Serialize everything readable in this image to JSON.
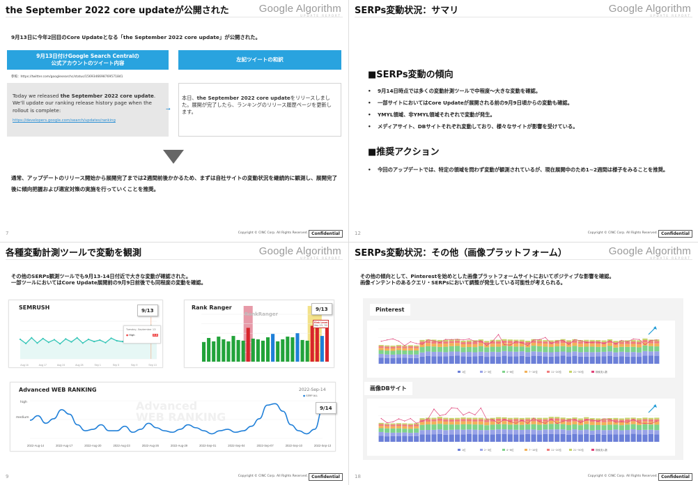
{
  "brand": "Google Algorithm",
  "brand_sub": "UPDATE REPORT",
  "copyright": "Copyright © CINC Corp. All Rights Reserved.",
  "confidential": "Confidential",
  "slide_tl": {
    "title": "the September 2022 core updateが公開された",
    "page": "7",
    "intro": "9月13日に今年2回目のCore Updateとなる「the September 2022 core update」が公開された。",
    "left_header_line1": "9月13日付けGoogle Search Centralの",
    "left_header_line2": "公式アカウントのツイート内容",
    "right_header": "左記ツイートの和訳",
    "reference": "参照：https://twitter.com/googlesearchc/status/1569346698769571841",
    "tweet_en_pre": "Today we released ",
    "tweet_en_bold": "the September 2022 core update",
    "tweet_en_post": ". We'll update our ranking release history page when the rollout is complete:",
    "tweet_en_link": "https://developers.google.com/search/updates/ranking",
    "tweet_ja_pre": "本日、",
    "tweet_ja_bold": "the September 2022 core update",
    "tweet_ja_post": "をリリースしました。展開が完了したら、ランキングのリリース履歴ページを更新します。",
    "conclusion": "通常、アップデートのリリース開始から展開完了までは2週間前後かかるため、まずは自社サイトの変動状況を継続的に観測し、展開完了後に傾向把握および適宜対策の実施を行っていくことを推奨。"
  },
  "slide_tr": {
    "title": "SERPs変動状況：サマリ",
    "page": "12",
    "section1": "■SERPs変動の傾向",
    "bullets1": [
      "9月14日時点では多くの変動計測ツールで中程度～大きな変動を確認。",
      "一部サイトにおいてはCore Updateが展開される前の9月9日頃からの変動も確認。",
      "YMYL領域、非YMYL領域それぞれで変動が発生。",
      "メディアサイト、DBサイトそれぞれ変動しており、様々なサイトが影響を受けている。"
    ],
    "section2": "■推奨アクション",
    "bullets2": [
      "今回のアップデートでは、特定の領域を問わず変動が観測されているが、現在展開中のため1~2週間は様子をみることを推奨。"
    ]
  },
  "slide_bl": {
    "title": "各種変動計測ツールで変動を観測",
    "page": "9",
    "intro_line1": "その他のSERPs観測ツールでも9月13-14日付近で大きな変動が確認された。",
    "intro_line2": "一部ツールにおいてはCore Update展開前の9月9日前後でも同程度の変動を確認。",
    "semrush_label": "SEMRUSH",
    "semrush_tag": "9/13",
    "semrush_ticks": [
      "Aug 16",
      "Aug 17",
      "Aug 24",
      "Aug 28",
      "Sep 1",
      "Sep 5",
      "Sep 9",
      "Sep 13"
    ],
    "semrush_tooltip_date": "Tuesday, September 13",
    "semrush_tooltip_level": "High",
    "semrush_tooltip_value": "8.8",
    "rankranger_label": "Rank Ranger",
    "rankranger_logo": "RankRanger",
    "rankranger_tag": "9/13",
    "rankranger_flag_line1": "Risk Level",
    "rankranger_flag_line2": "Sep 13, '22",
    "awr_label": "Advanced WEB RANKING",
    "awr_date": "2022-Sep-14",
    "awr_legend": "SERP ALL",
    "awr_tag": "9/14",
    "awr_watermark_line1": "Advanced",
    "awr_watermark_line2": "WEB RANKING",
    "awr_y_high": "high",
    "awr_y_medium": "medium",
    "awr_ticks": [
      "2022-Aug-14",
      "2022-Aug-17",
      "2022-Aug-20",
      "2022-Aug-23",
      "2022-Aug-26",
      "2022-Aug-29",
      "2022-Sep-01",
      "2022-Sep-04",
      "2022-Sep-07",
      "2022-Sep-10",
      "2022-Sep-13"
    ]
  },
  "slide_br": {
    "title": "SERPs変動状況：その他（画像プラットフォーム）",
    "page": "18",
    "intro_line1": "その他の傾向として、Pinterestを始めとした画像プラットフォームサイトにおいてポジティブな影響を確認。",
    "intro_line2": "画像インテントのあるクエリ・SERPsにおいて調整が発生している可能性が考えられる。",
    "pinterest_label": "Pinterest",
    "imagedb_label": "画像DBサイト",
    "legend": [
      "1位",
      "2~3位",
      "4~6位",
      "7~10位",
      "11~20位",
      "21~50位",
      "検索流入数"
    ]
  },
  "colors": {
    "header_blue": "#29a3df",
    "line_blue": "#1f7fd8",
    "semrush_line": "#33c5b7",
    "green": "#22a33a",
    "red": "#d8242b",
    "pink_band": "#e79aa8",
    "yellow_band": "#f3e28a"
  },
  "chart_data": [
    {
      "type": "line",
      "title": "SEMRUSH",
      "x": [
        "Aug 16",
        "Aug 17",
        "Aug 24",
        "Aug 28",
        "Sep 1",
        "Sep 5",
        "Sep 9",
        "Sep 13"
      ],
      "series": [
        {
          "values": [
            5.2,
            4.1,
            5.6,
            4.2,
            5.4,
            4.4,
            5.1,
            4.0,
            5.3,
            4.5,
            5.6,
            4.2,
            5.2,
            4.6,
            5.0,
            4.3,
            5.5,
            4.8,
            4.6,
            5.0,
            4.7,
            5.8,
            6.6,
            8.8,
            7.2
          ]
        }
      ],
      "annotations": [
        "9/13"
      ]
    },
    {
      "type": "bar",
      "title": "Rank Ranger",
      "series": [
        {
          "values": [
            2.9,
            3.5,
            3.0,
            3.7,
            3.3,
            3.0,
            3.8,
            3.2,
            3.1,
            5.0,
            3.4,
            3.3,
            3.1,
            3.6,
            4.1,
            3.0,
            3.3,
            3.7,
            3.6,
            4.2,
            3.2,
            3.1,
            5.3,
            6.1,
            3.8,
            5.3
          ]
        }
      ],
      "annotations": [
        "9/13"
      ]
    },
    {
      "type": "line",
      "title": "Advanced WEB RANKING",
      "x": [
        "2022-Aug-14",
        "2022-Aug-17",
        "2022-Aug-20",
        "2022-Aug-23",
        "2022-Aug-26",
        "2022-Aug-29",
        "2022-Sep-01",
        "2022-Sep-04",
        "2022-Sep-07",
        "2022-Sep-10",
        "2022-Sep-13"
      ],
      "series": [
        {
          "name": "SERP ALL",
          "values": [
            1.2,
            1.5,
            1.0,
            1.3,
            1.9,
            1.6,
            0.9,
            0.5,
            0.6,
            0.9,
            0.5,
            0.5,
            0.8,
            0.4,
            0.6,
            1.0,
            0.7,
            0.5,
            0.4,
            0.6,
            0.9,
            0.7,
            0.5,
            0.3,
            0.5,
            0.6,
            0.4,
            0.5,
            0.8,
            1.3,
            2.2,
            2.3,
            1.8,
            0.9,
            0.5,
            0.3,
            0.6,
            1.9
          ]
        }
      ],
      "annotations": [
        "9/14"
      ]
    }
  ]
}
